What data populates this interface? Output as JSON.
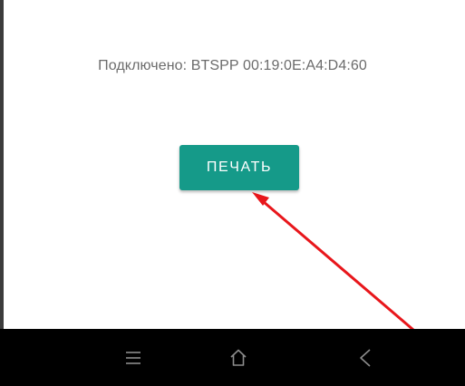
{
  "status": {
    "connected_text": "Подключено: BTSPP 00:19:0E:A4:D4:60"
  },
  "actions": {
    "print_label": "ПЕЧАТЬ"
  },
  "colors": {
    "button_bg": "#159a89",
    "button_text": "#ffffff",
    "status_text": "#6b6b6b",
    "annotation_arrow": "#e8161b",
    "nav_bar_bg": "#000000",
    "nav_icon": "#8c8c8c"
  },
  "navigation": {
    "icons": [
      "recents-icon",
      "home-icon",
      "back-icon"
    ]
  },
  "annotation": {
    "type": "arrow",
    "target": "print-button"
  }
}
